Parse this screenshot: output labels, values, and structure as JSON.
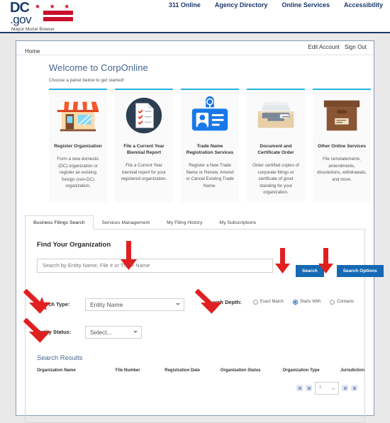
{
  "brand": {
    "logo_dc": "DC",
    "logo_gov": ".gov",
    "logo_stars": "★ ★ ★",
    "mayor": "Mayor Muriel Bowser",
    "accent_blue": "#1b3a6b",
    "accent_red": "#c8102e"
  },
  "topnav": {
    "items": [
      {
        "label": "311 Online"
      },
      {
        "label": "Agency Directory"
      },
      {
        "label": "Online Services"
      },
      {
        "label": "Accessibility"
      }
    ]
  },
  "breadcrumb": {
    "home": "Home",
    "edit_account": "Edit Account",
    "sign_out": "Sign Out"
  },
  "welcome": {
    "title": "Welcome to CorpOnline",
    "subtitle": "Choose a panel below to get started!"
  },
  "panels": {
    "accent_top": "#24b3e0",
    "cards": [
      {
        "icon": "storefront-icon",
        "title": "Register Organization",
        "desc": "Form a new domestic (DC) organization or register an existing foreign (non-DC) organization."
      },
      {
        "icon": "checklist-document-icon",
        "title": "File a Current Year Biennial Report",
        "desc": "File a Current Year biennial report for your registered organization."
      },
      {
        "icon": "id-badge-icon",
        "title": "Trade Name Registration Services",
        "desc": "Register a New Trade Name or Renew, Amend or Cancel Existing Trade Name."
      },
      {
        "icon": "file-tray-icon",
        "title": "Document and Certificate Order",
        "desc": "Order certified copies of corporate filings or certificate of good standing for your organization."
      },
      {
        "icon": "archive-box-icon",
        "title": "Other Online Services",
        "desc": "File reinstatements, amendments, dissolutions, withdrawals, and more."
      }
    ]
  },
  "tabs": [
    {
      "label": "Business Filings Search",
      "active": true
    },
    {
      "label": "Services Management",
      "active": false
    },
    {
      "label": "My Filing History",
      "active": false
    },
    {
      "label": "My Subscriptions",
      "active": false
    }
  ],
  "search": {
    "heading": "Find Your Organization",
    "placeholder": "Search by Entity Name, File # or Trade Name",
    "value": "",
    "search_button": "Search",
    "options_button": "Search Options",
    "button_color": "#1669b3",
    "search_type_label": "Search Type:",
    "search_type_value": "Entity Name",
    "entity_status_label": "Entity Status:",
    "entity_status_value": "Select...",
    "search_depth_label": "Search Depth:",
    "depth_options": [
      {
        "label": "Exact Match",
        "selected": false
      },
      {
        "label": "Starts With",
        "selected": true
      },
      {
        "label": "Contains",
        "selected": false
      }
    ]
  },
  "results": {
    "heading": "Search Results",
    "columns": [
      "Organization Name",
      "File Number",
      "Registration Date",
      "Organization Status",
      "Organization Type",
      "Jurisdiction"
    ],
    "rows": [],
    "page_value": "1"
  },
  "annotations": {
    "color": "#e02020",
    "arrows": [
      {
        "target": "search-input"
      },
      {
        "target": "search-button"
      },
      {
        "target": "search-options-button"
      },
      {
        "target": "search-type-label"
      },
      {
        "target": "entity-status-label"
      },
      {
        "target": "search-depth-label"
      }
    ]
  }
}
